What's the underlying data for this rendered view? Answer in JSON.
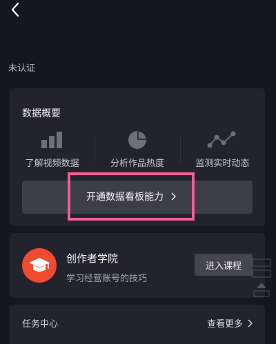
{
  "header": {
    "back_icon": "chevron-left-icon"
  },
  "account": {
    "status": "未认证"
  },
  "data_overview": {
    "title": "数据概要",
    "features": [
      {
        "icon": "bar-chart-icon",
        "label": "了解视频数据"
      },
      {
        "icon": "pie-chart-icon",
        "label": "分析作品热度"
      },
      {
        "icon": "line-chart-icon",
        "label": "监测实时动态"
      }
    ],
    "open_button": {
      "label": "开通数据看板能力",
      "icon": "chevron-right-icon"
    },
    "highlight_color": "#ef5f95"
  },
  "academy": {
    "icon": "graduation-cap-icon",
    "icon_color": "#ef4b2c",
    "title": "创作者学院",
    "subtitle": "学习经营账号的技巧",
    "button_label": "进入课程"
  },
  "task_center": {
    "title": "任务中心",
    "more_label": "查看更多",
    "more_icon": "chevron-right-icon"
  }
}
